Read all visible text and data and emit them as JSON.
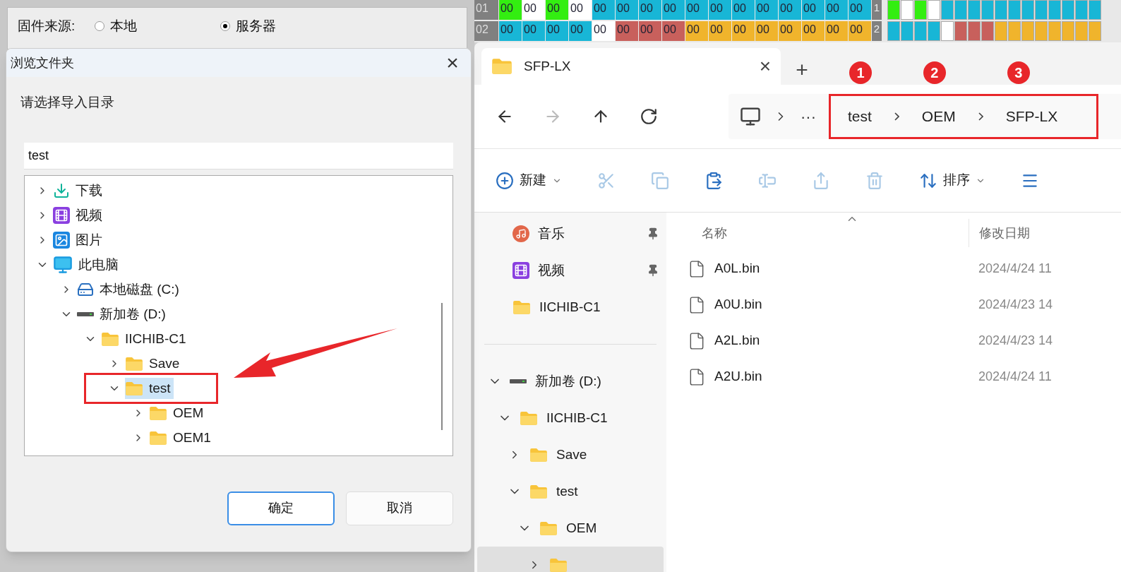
{
  "background_app": {
    "source_label": "固件来源:",
    "source_options": [
      {
        "label": "本地",
        "selected": false
      },
      {
        "label": "服务器",
        "selected": true
      }
    ]
  },
  "hex_grid": {
    "rows": [
      {
        "label": "01",
        "index": "1",
        "cells": [
          {
            "text": "00",
            "color": "#33ee11"
          },
          {
            "text": "00",
            "color": "#ffffff"
          },
          {
            "text": "00",
            "color": "#33ee11"
          },
          {
            "text": "00",
            "color": "#ffffff"
          },
          {
            "text": "00",
            "color": "#18b6d6"
          },
          {
            "text": "00",
            "color": "#18b6d6"
          },
          {
            "text": "00",
            "color": "#18b6d6"
          },
          {
            "text": "00",
            "color": "#18b6d6"
          },
          {
            "text": "00",
            "color": "#18b6d6"
          },
          {
            "text": "00",
            "color": "#18b6d6"
          },
          {
            "text": "00",
            "color": "#18b6d6"
          },
          {
            "text": "00",
            "color": "#18b6d6"
          },
          {
            "text": "00",
            "color": "#18b6d6"
          },
          {
            "text": "00",
            "color": "#18b6d6"
          },
          {
            "text": "00",
            "color": "#18b6d6"
          },
          {
            "text": "00",
            "color": "#18b6d6"
          }
        ]
      },
      {
        "label": "02",
        "index": "2",
        "cells": [
          {
            "text": "00",
            "color": "#18b6d6"
          },
          {
            "text": "00",
            "color": "#18b6d6"
          },
          {
            "text": "00",
            "color": "#18b6d6"
          },
          {
            "text": "00",
            "color": "#18b6d6"
          },
          {
            "text": "00",
            "color": "#ffffff"
          },
          {
            "text": "00",
            "color": "#c8605c"
          },
          {
            "text": "00",
            "color": "#c8605c"
          },
          {
            "text": "00",
            "color": "#c8605c"
          },
          {
            "text": "00",
            "color": "#f0b42c"
          },
          {
            "text": "00",
            "color": "#f0b42c"
          },
          {
            "text": "00",
            "color": "#f0b42c"
          },
          {
            "text": "00",
            "color": "#f0b42c"
          },
          {
            "text": "00",
            "color": "#f0b42c"
          },
          {
            "text": "00",
            "color": "#f0b42c"
          },
          {
            "text": "00",
            "color": "#f0b42c"
          },
          {
            "text": "00",
            "color": "#f0b42c"
          }
        ]
      }
    ]
  },
  "dialog": {
    "title": "浏览文件夹",
    "close": "×",
    "prompt": "请选择导入目录",
    "path_value": "test",
    "tree": [
      {
        "label": "下载",
        "kind": "download",
        "expanded": false,
        "selected": false
      },
      {
        "label": "视频",
        "kind": "video",
        "expanded": false,
        "selected": false
      },
      {
        "label": "图片",
        "kind": "picture",
        "expanded": false,
        "selected": false
      },
      {
        "label": "此电脑",
        "kind": "computer",
        "expanded": true,
        "selected": false,
        "children": [
          {
            "label": "本地磁盘 (C:)",
            "kind": "system-drive",
            "expanded": false,
            "selected": false
          },
          {
            "label": "新加卷 (D:)",
            "kind": "drive",
            "expanded": true,
            "selected": false,
            "children": [
              {
                "label": "IICHIB-C1",
                "kind": "folder",
                "expanded": true,
                "selected": false,
                "children": [
                  {
                    "label": "Save",
                    "kind": "folder",
                    "expanded": false,
                    "selected": false
                  },
                  {
                    "label": "test",
                    "kind": "folder",
                    "expanded": true,
                    "selected": true,
                    "highlighted": true,
                    "children": [
                      {
                        "label": "OEM",
                        "kind": "folder",
                        "expanded": false,
                        "selected": false
                      },
                      {
                        "label": "OEM1",
                        "kind": "folder",
                        "expanded": false,
                        "selected": false
                      }
                    ]
                  }
                ]
              }
            ]
          }
        ]
      }
    ],
    "buttons": [
      {
        "label": "确定",
        "default": true
      },
      {
        "label": "取消",
        "default": false
      }
    ]
  },
  "explorer": {
    "tab": {
      "title": "SFP-LX",
      "close": "×"
    },
    "new_tab": "+",
    "nav": [
      {
        "kind": "back",
        "disabled": false
      },
      {
        "kind": "forward",
        "disabled": true
      },
      {
        "kind": "up",
        "disabled": false
      },
      {
        "kind": "refresh",
        "disabled": false
      }
    ],
    "address": {
      "overflow": "···",
      "breadcrumbs": [
        {
          "label": "test",
          "badge": "1"
        },
        {
          "label": "OEM",
          "badge": "2"
        },
        {
          "label": "SFP-LX",
          "badge": "3"
        }
      ]
    },
    "toolbar": [
      {
        "kind": "new",
        "label": "新建",
        "disabled": false
      },
      {
        "kind": "cut",
        "disabled": true
      },
      {
        "kind": "copy",
        "disabled": true
      },
      {
        "kind": "paste",
        "disabled": false
      },
      {
        "kind": "rename",
        "disabled": true
      },
      {
        "kind": "share",
        "disabled": true
      },
      {
        "kind": "delete",
        "disabled": true
      },
      {
        "kind": "sort",
        "label": "排序",
        "disabled": false
      },
      {
        "kind": "view",
        "disabled": false
      }
    ],
    "quick_access": [
      {
        "label": "音乐",
        "kind": "music",
        "pinned": true
      },
      {
        "label": "视频",
        "kind": "video",
        "pinned": true
      },
      {
        "label": "IICHIB-C1",
        "kind": "folder",
        "pinned": false
      }
    ],
    "tree": [
      {
        "label": "新加卷 (D:)",
        "kind": "drive",
        "expanded": true,
        "selected": false,
        "children": [
          {
            "label": "IICHIB-C1",
            "kind": "folder",
            "expanded": true,
            "selected": false,
            "children": [
              {
                "label": "Save",
                "kind": "folder",
                "expanded": false,
                "selected": false
              },
              {
                "label": "test",
                "kind": "folder",
                "expanded": true,
                "selected": false,
                "children": [
                  {
                    "label": "OEM",
                    "kind": "folder",
                    "expanded": true,
                    "selected": false,
                    "children": [
                      {
                        "kind": "folder",
                        "expanded": false,
                        "selected": true
                      }
                    ]
                  }
                ]
              }
            ]
          }
        ]
      }
    ],
    "columns": [
      "名称",
      "修改日期"
    ],
    "files": [
      {
        "name": "A0L.bin",
        "modified": "2024/4/24 11"
      },
      {
        "name": "A0U.bin",
        "modified": "2024/4/23 14"
      },
      {
        "name": "A2L.bin",
        "modified": "2024/4/23 14"
      },
      {
        "name": "A2U.bin",
        "modified": "2024/4/24 11"
      }
    ]
  }
}
